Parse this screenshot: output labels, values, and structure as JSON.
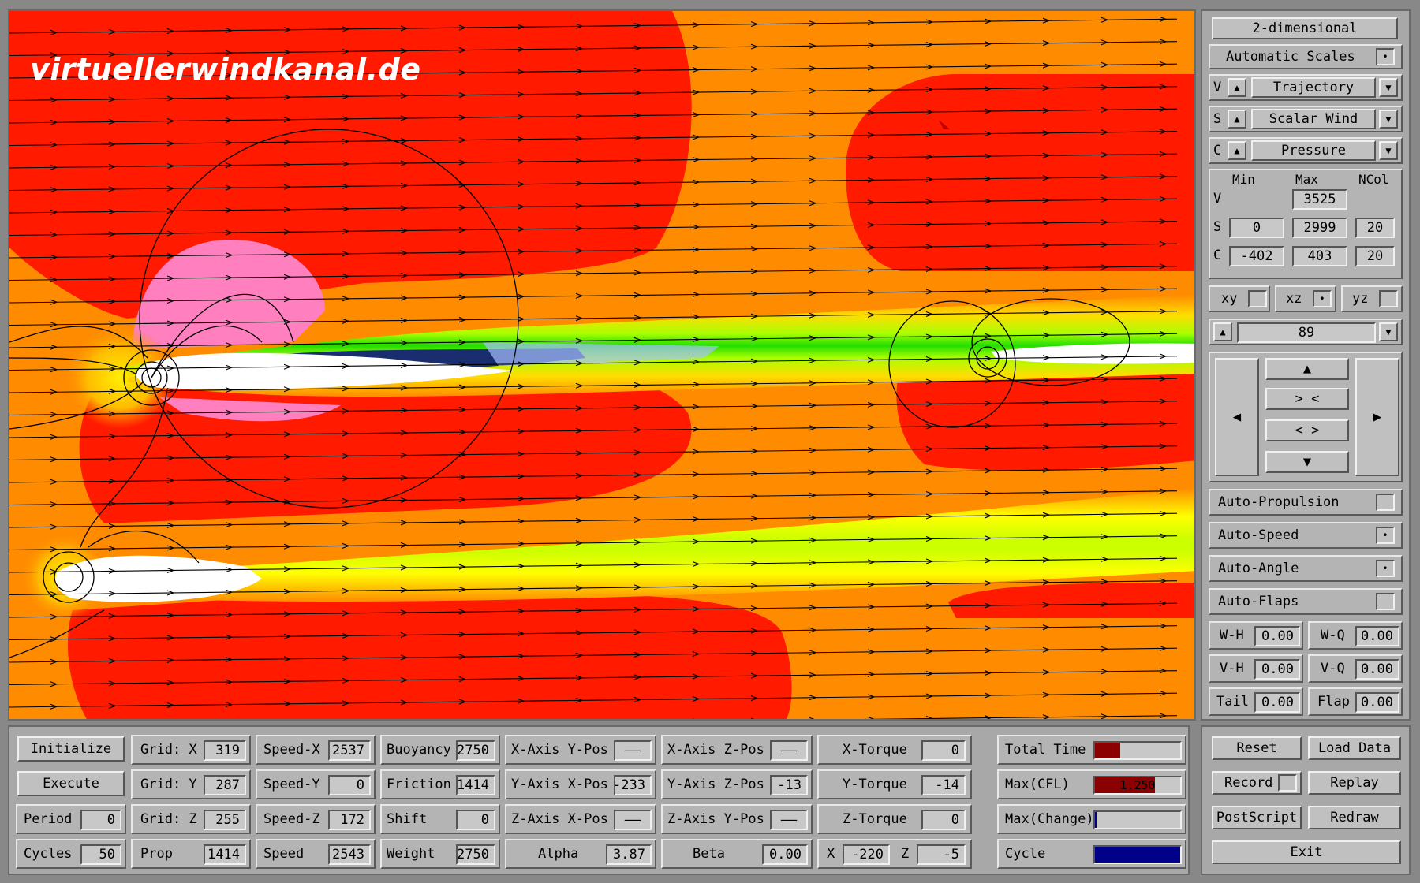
{
  "watermark": "virtuellerwindkanal.de",
  "right": {
    "mode_button": "2-dimensional",
    "auto_scales": "Automatic Scales",
    "auto_scales_checked": "•",
    "v_row": {
      "letter": "V",
      "value": "Trajectory"
    },
    "s_row": {
      "letter": "S",
      "value": "Scalar Wind"
    },
    "c_row": {
      "letter": "C",
      "value": "Pressure"
    },
    "scale_headers": {
      "min": "Min",
      "max": "Max",
      "ncol": "NCol"
    },
    "scale_v": {
      "letter": "V",
      "max": "3525"
    },
    "scale_s": {
      "letter": "S",
      "min": "0",
      "max": "2999",
      "ncol": "20"
    },
    "scale_c": {
      "letter": "C",
      "min": "-402",
      "max": "403",
      "ncol": "20"
    },
    "planes": {
      "xy": "xy",
      "xz": "xz",
      "yz": "yz",
      "xz_checked": "•"
    },
    "slice": "89",
    "nav": {
      "up": "▲",
      "down": "▼",
      "left": "◀",
      "right": "▶",
      "zoom_in": "> <",
      "zoom_out": "< >"
    },
    "auto": [
      {
        "label": "Auto-Propulsion",
        "checked": ""
      },
      {
        "label": "Auto-Speed",
        "checked": "•"
      },
      {
        "label": "Auto-Angle",
        "checked": "•"
      },
      {
        "label": "Auto-Flaps",
        "checked": ""
      }
    ],
    "params": [
      {
        "label": "W-H",
        "value": "0.00"
      },
      {
        "label": "W-Q",
        "value": "0.00"
      },
      {
        "label": "V-H",
        "value": "0.00"
      },
      {
        "label": "V-Q",
        "value": "0.00"
      },
      {
        "label": "Tail",
        "value": "0.00"
      },
      {
        "label": "Flap",
        "value": "0.00"
      }
    ]
  },
  "bottom": {
    "initialize": "Initialize",
    "execute": "Execute",
    "period": {
      "label": "Period",
      "value": "0"
    },
    "cycles": {
      "label": "Cycles",
      "value": "50"
    },
    "grid_x": {
      "label": "Grid: X",
      "value": "319"
    },
    "grid_y": {
      "label": "Grid: Y",
      "value": "287"
    },
    "grid_z": {
      "label": "Grid: Z",
      "value": "255"
    },
    "prop": {
      "label": "Prop",
      "value": "1414"
    },
    "speed_x": {
      "label": "Speed-X",
      "value": "2537"
    },
    "speed_y": {
      "label": "Speed-Y",
      "value": "0"
    },
    "speed_z": {
      "label": "Speed-Z",
      "value": "172"
    },
    "speed": {
      "label": "Speed",
      "value": "2543"
    },
    "buoyancy": {
      "label": "Buoyancy",
      "value": "2750"
    },
    "friction": {
      "label": "Friction",
      "value": "1414"
    },
    "shift": {
      "label": "Shift",
      "value": "0"
    },
    "weight": {
      "label": "Weight",
      "value": "2750"
    },
    "xaxis_ypos": {
      "label": "X-Axis Y-Pos",
      "value": "——"
    },
    "yaxis_xpos": {
      "label": "Y-Axis X-Pos",
      "value": "-233"
    },
    "zaxis_xpos": {
      "label": "Z-Axis X-Pos",
      "value": "——"
    },
    "alpha": {
      "label": "Alpha",
      "value": "3.87"
    },
    "xaxis_zpos": {
      "label": "X-Axis Z-Pos",
      "value": "——"
    },
    "yaxis_zpos": {
      "label": "Y-Axis Z-Pos",
      "value": "-13"
    },
    "zaxis_ypos": {
      "label": "Z-Axis Y-Pos",
      "value": "——"
    },
    "beta": {
      "label": "Beta",
      "value": "0.00"
    },
    "x_torque": {
      "label": "X-Torque",
      "value": "0"
    },
    "y_torque": {
      "label": "Y-Torque",
      "value": "-14"
    },
    "z_torque": {
      "label": "Z-Torque",
      "value": "0"
    },
    "x_pos": {
      "label": "X",
      "value": "-220"
    },
    "z_pos": {
      "label": "Z",
      "value": "-5"
    },
    "total_time": {
      "label": "Total Time",
      "fraction": 0.3,
      "color": "#8b0000"
    },
    "max_cfl": {
      "label": "Max(CFL)",
      "value": "1.250",
      "fraction": 0.7,
      "color": "#8b0000"
    },
    "max_change": {
      "label": "Max(Change)",
      "fraction": 0.02,
      "color": "#00008b"
    },
    "cycle": {
      "label": "Cycle",
      "fraction": 1.0,
      "color": "#00008b"
    }
  },
  "actions": {
    "reset": "Reset",
    "load_data": "Load Data",
    "record": "Record",
    "replay": "Replay",
    "postscript": "PostScript",
    "redraw": "Redraw",
    "exit": "Exit"
  },
  "colors": {
    "field_orange": "#ff8c00",
    "field_red": "#ff1a00",
    "wake_yellow": "#ffff00",
    "wake_green": "#22dd00",
    "pink": "#ff7fbf",
    "panel_grey": "#a8a8a8"
  }
}
